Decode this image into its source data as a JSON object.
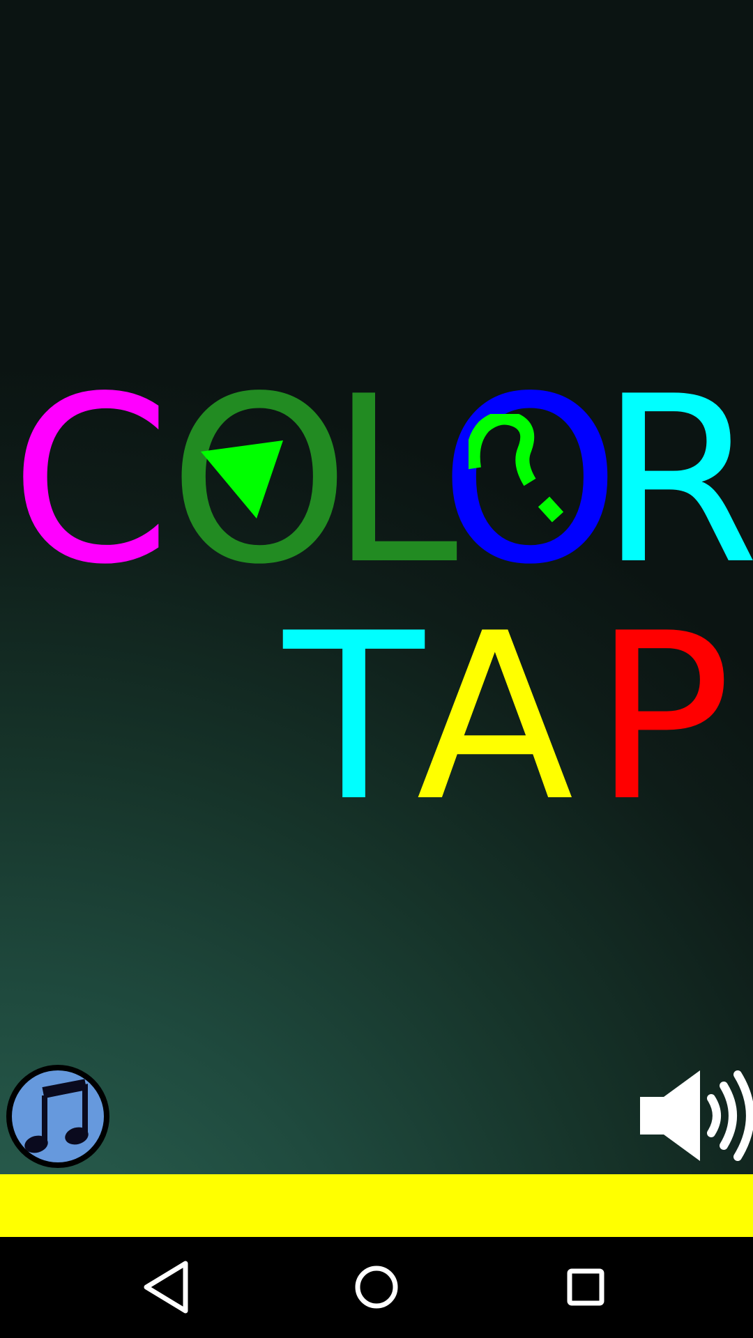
{
  "title": {
    "row1": [
      {
        "char": "C",
        "color": "#ff00ff"
      },
      {
        "char": "O",
        "color": "#228b22"
      },
      {
        "char": "L",
        "color": "#228b22"
      },
      {
        "char": "O",
        "color": "#0000ff"
      },
      {
        "char": "R",
        "color": "#00ffff"
      }
    ],
    "row2": [
      {
        "char": "T",
        "color": "#00ffff"
      },
      {
        "char": "A",
        "color": "#ffff00"
      },
      {
        "char": "P",
        "color": "#ff0000"
      }
    ]
  },
  "colors": {
    "overlay_green": "#00ff00",
    "music_button": "#6699dd",
    "sound_icon": "#ffffff",
    "bottom_bar": "#ffff00",
    "nav_bar": "#000000",
    "nav_icons": "#ffffff"
  },
  "icons": {
    "play": "play-triangle-icon",
    "help": "question-mark-icon",
    "music": "music-note-icon",
    "sound": "speaker-volume-icon",
    "nav_back": "back-triangle-icon",
    "nav_home": "home-circle-icon",
    "nav_recent": "recent-square-icon"
  }
}
